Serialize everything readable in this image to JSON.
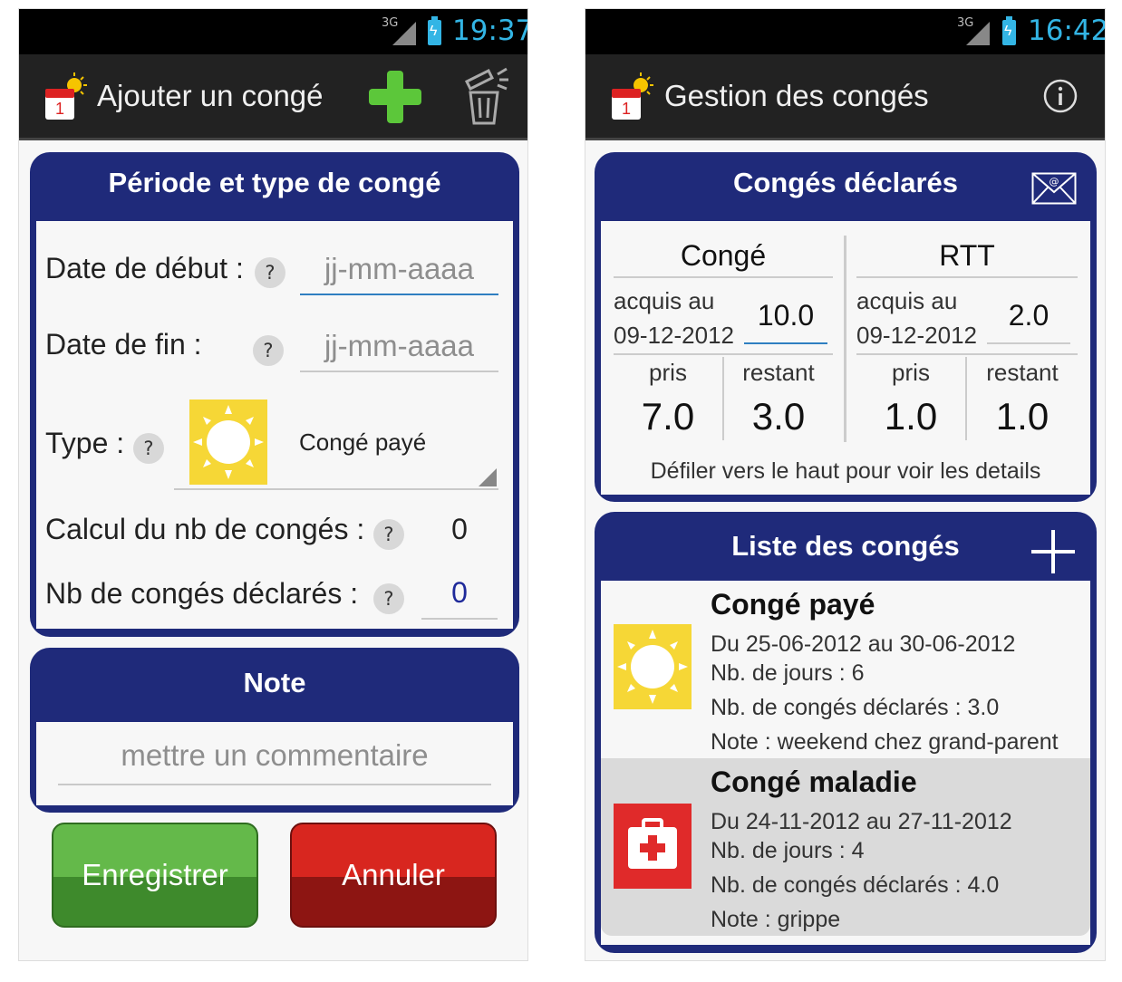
{
  "left_screen": {
    "status": {
      "network": "3G",
      "time": "19:37"
    },
    "actionbar": {
      "title": "Ajouter un congé",
      "add_icon": "plus-icon",
      "delete_icon": "trash-icon"
    },
    "period_card": {
      "title": "Période et type de congé",
      "start_label": "Date de début :",
      "start_placeholder": "jj-mm-aaaa",
      "end_label": "Date de fin :",
      "end_placeholder": "jj-mm-aaaa",
      "type_label": "Type :",
      "type_value": "Congé payé",
      "calc_label": "Calcul du nb de congés :",
      "calc_value": "0",
      "declared_label": "Nb de congés déclarés :",
      "declared_value": "0",
      "help_mark": "?"
    },
    "note_card": {
      "title": "Note",
      "placeholder": "mettre un commentaire"
    },
    "buttons": {
      "save": "Enregistrer",
      "cancel": "Annuler"
    },
    "colors": {
      "save": "#4f9d3a",
      "cancel": "#c4221c"
    }
  },
  "right_screen": {
    "status": {
      "network": "3G",
      "time": "16:42"
    },
    "actionbar": {
      "title": "Gestion des congés",
      "info_icon": "info-icon"
    },
    "summary_card": {
      "title": "Congés déclarés",
      "conge": {
        "header": "Congé",
        "acquired_label_1": "acquis au",
        "acquired_label_2": "09-12-2012",
        "acquired_value": "10.0",
        "taken_label": "pris",
        "taken_value": "7.0",
        "remaining_label": "restant",
        "remaining_value": "3.0"
      },
      "rtt": {
        "header": "RTT",
        "acquired_label_1": "acquis au",
        "acquired_label_2": "09-12-2012",
        "acquired_value": "2.0",
        "taken_label": "pris",
        "taken_value": "1.0",
        "remaining_label": "restant",
        "remaining_value": "1.0"
      },
      "hint": "Défiler vers le haut pour voir les details"
    },
    "list_card": {
      "title": "Liste des congés",
      "items": [
        {
          "title": "Congé payé",
          "dates": "Du 25-06-2012 au 30-06-2012",
          "days": "Nb. de jours : 6",
          "declared": "Nb. de congés déclarés : 3.0",
          "note": "Note : weekend chez grand-parent",
          "icon": "sun-icon"
        },
        {
          "title": "Congé maladie",
          "dates": "Du 24-11-2012 au 27-11-2012",
          "days": "Nb. de jours : 4",
          "declared": "Nb. de congés déclarés : 4.0",
          "note": "Note : grippe",
          "icon": "first-aid-icon"
        }
      ]
    }
  },
  "colors": {
    "card_blue": "#1f2a7a",
    "accent": "#33b5e5",
    "sun_yellow": "#f6d736",
    "medical_red": "#e02a2a"
  }
}
